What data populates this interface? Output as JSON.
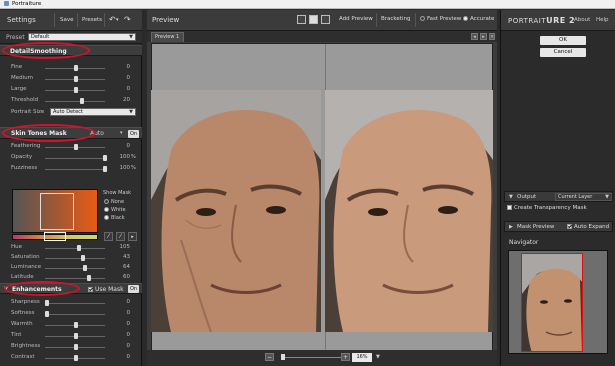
{
  "window": {
    "title": "Portraiture"
  },
  "left_panel": {
    "title": "Settings",
    "toolbar": {
      "save": "Save",
      "presets": "Presets",
      "undo": "↶",
      "redo": "↷"
    },
    "preset": {
      "label": "Preset",
      "value": "Default"
    },
    "detail_smoothing": {
      "title": "DetailSmoothing",
      "sliders": [
        {
          "label": "Fine",
          "value": "0",
          "level": 0.5
        },
        {
          "label": "Medium",
          "value": "0",
          "level": 0.5
        },
        {
          "label": "Large",
          "value": "0",
          "level": 0.5
        },
        {
          "label": "Threshold",
          "value": "20",
          "level": 0.6
        }
      ],
      "portrait_size": {
        "label": "Portrait Size",
        "value": "Auto Detect"
      }
    },
    "skin_tones_mask": {
      "title": "Skin Tones Mask",
      "mode": "Auto",
      "toggle": "On",
      "sliders": [
        {
          "label": "Feathering",
          "value": "0",
          "unit": "",
          "level": 0.5
        },
        {
          "label": "Opacity",
          "value": "100",
          "unit": "%",
          "level": 1.0
        },
        {
          "label": "Fuzziness",
          "value": "100",
          "unit": "%",
          "level": 1.0
        }
      ],
      "show_mask": {
        "label": "Show Mask",
        "options": [
          "None",
          "White",
          "Black"
        ],
        "selected": "None"
      },
      "hsl": [
        {
          "label": "Hue",
          "value": "105",
          "level": 0.55
        },
        {
          "label": "Saturation",
          "value": "43",
          "level": 0.62
        },
        {
          "label": "Luminance",
          "value": "64",
          "level": 0.65
        },
        {
          "label": "Latitude",
          "value": "60",
          "level": 0.72
        }
      ]
    },
    "enhancements": {
      "title": "Enhancements",
      "use_mask": "Use Mask",
      "toggle": "On",
      "sliders": [
        {
          "label": "Sharpness",
          "value": "0",
          "level": 0.0
        },
        {
          "label": "Softness",
          "value": "0",
          "level": 0.0
        },
        {
          "label": "Warmth",
          "value": "0",
          "level": 0.5
        },
        {
          "label": "Tint",
          "value": "0",
          "level": 0.5
        },
        {
          "label": "Brightness",
          "value": "0",
          "level": 0.5
        },
        {
          "label": "Contrast",
          "value": "0",
          "level": 0.5
        }
      ]
    }
  },
  "center": {
    "title": "Preview",
    "add_preview": "Add Preview",
    "bracketing": "Bracketing",
    "fast_preview": "Fast Preview",
    "accurate": "Accurate",
    "tab": "Preview 1",
    "zoom": "16%"
  },
  "right_panel": {
    "logo_a": "PORTRAIT",
    "logo_b": "URE 2",
    "about": "About",
    "help": "Help",
    "ok": "OK",
    "cancel": "Cancel",
    "output": {
      "label": "Output",
      "value": "Current Layer"
    },
    "create_mask": "Create Transparency Mask",
    "mask_preview": "Mask Preview",
    "auto_expand": "Auto Expand",
    "navigator": "Navigator"
  },
  "colors": {
    "accent_red": "#d0142c",
    "panel_bg": "#2e2e2e",
    "skin": "#c99a7c"
  }
}
